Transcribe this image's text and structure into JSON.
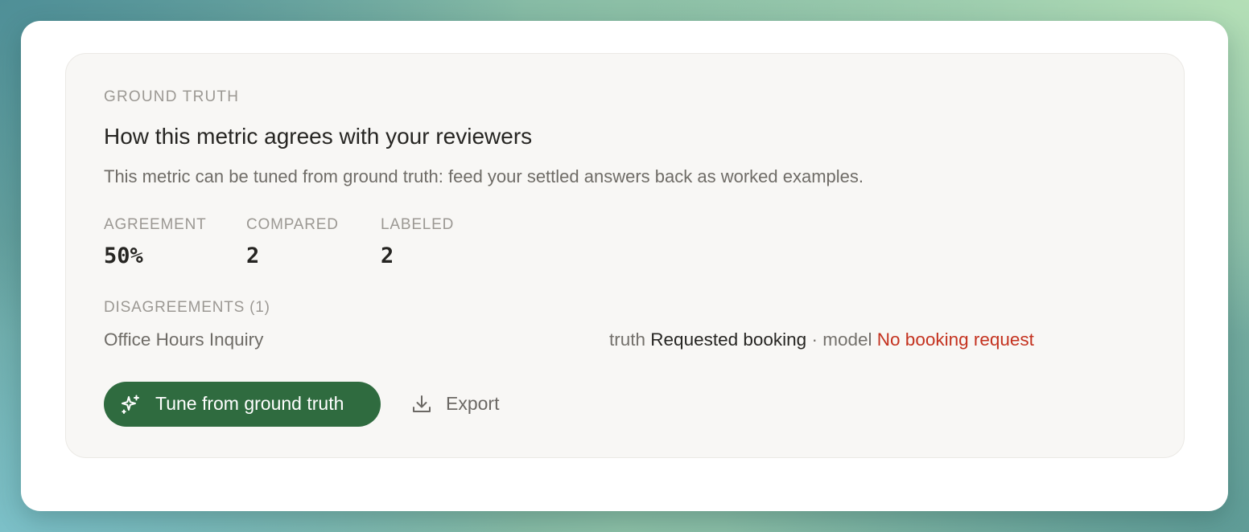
{
  "section": {
    "eyebrow": "GROUND TRUTH",
    "title": "How this metric agrees with your reviewers",
    "description": "This metric can be tuned from ground truth: feed your settled answers back as worked examples."
  },
  "stats": [
    {
      "label": "AGREEMENT",
      "value": "50%"
    },
    {
      "label": "COMPARED",
      "value": "2"
    },
    {
      "label": "LABELED",
      "value": "2"
    }
  ],
  "disagreements": {
    "heading": "DISAGREEMENTS (1)",
    "rows": [
      {
        "name": "Office Hours Inquiry",
        "truth_label": "truth",
        "truth_value": "Requested booking",
        "separator": "·",
        "model_label": "model",
        "model_value": "No booking request"
      }
    ]
  },
  "actions": {
    "tune_label": "Tune from ground truth",
    "tune_icon": "sparkles-icon",
    "export_label": "Export",
    "export_icon": "download-icon"
  },
  "colors": {
    "primary_button": "#2f6b3f",
    "model_value": "#c4321f"
  }
}
